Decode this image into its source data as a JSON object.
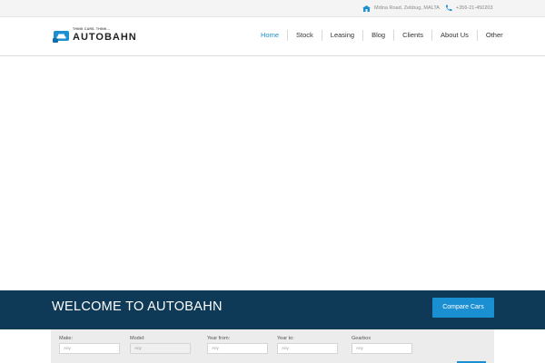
{
  "topbar": {
    "address": "Mdina Road, Zebbug, MALTA",
    "phone": "+356-21-450203"
  },
  "brand": {
    "tagline": "THINK CARS. THINK...",
    "name": "AUTOBAHN"
  },
  "nav": {
    "items": [
      "Home",
      "Stock",
      "Leasing",
      "Blog",
      "Clients",
      "About Us",
      "Other"
    ],
    "active": "Home"
  },
  "welcome": {
    "title": "WELCOME TO AUTOBAHN",
    "compare_label": "Compare Cars"
  },
  "search": {
    "fields": [
      {
        "label": "Make:",
        "placeholder": "Any"
      },
      {
        "label": "Model:",
        "placeholder": "Any"
      },
      {
        "label": "Year from:",
        "placeholder": "Any"
      },
      {
        "label": "Year to:",
        "placeholder": "Any"
      },
      {
        "label": "Gearbox",
        "placeholder": "Any"
      }
    ]
  },
  "colors": {
    "accent": "#1a8fd1",
    "band": "#0f3a57"
  }
}
